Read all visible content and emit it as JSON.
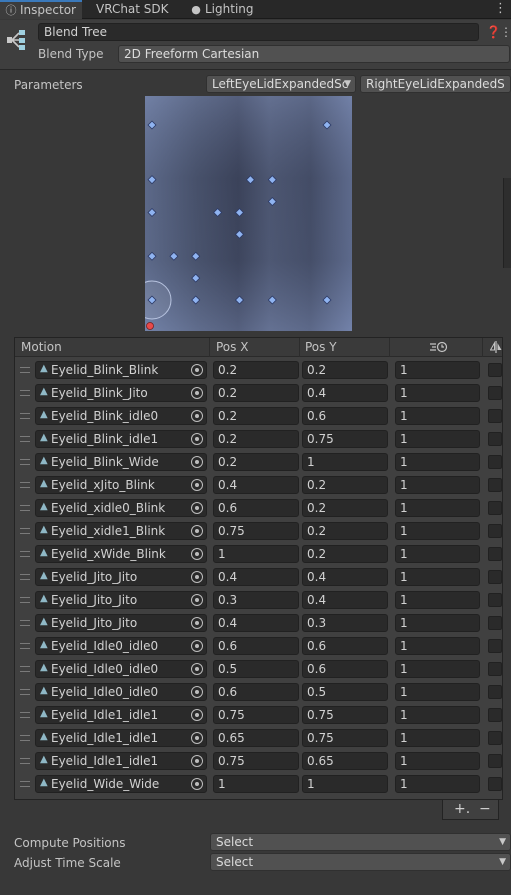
{
  "tabs": [
    {
      "label": "Inspector",
      "icon": "info-icon",
      "active": true
    },
    {
      "label": "VRChat SDK",
      "icon": "",
      "active": false
    },
    {
      "label": "Lighting",
      "icon": "lightbulb-icon",
      "active": false
    }
  ],
  "header": {
    "name": "Blend Tree",
    "blend_type_label": "Blend Type",
    "blend_type_value": "2D Freeform Cartesian"
  },
  "parameters": {
    "label": "Parameters",
    "x_param": "LeftEyeLidExpandedSc",
    "y_param": "RightEyeLidExpandedS"
  },
  "table": {
    "headers": {
      "motion": "Motion",
      "pos_x": "Pos X",
      "pos_y": "Pos Y"
    },
    "rows": [
      {
        "motion": "Eyelid_Blink_Blink",
        "x": "0.2",
        "y": "0.2",
        "speed": "1"
      },
      {
        "motion": "Eyelid_Blink_Jito",
        "x": "0.2",
        "y": "0.4",
        "speed": "1"
      },
      {
        "motion": "Eyelid_Blink_idle0",
        "x": "0.2",
        "y": "0.6",
        "speed": "1"
      },
      {
        "motion": "Eyelid_Blink_idle1",
        "x": "0.2",
        "y": "0.75",
        "speed": "1"
      },
      {
        "motion": "Eyelid_Blink_Wide",
        "x": "0.2",
        "y": "1",
        "speed": "1"
      },
      {
        "motion": "Eyelid_xJito_Blink",
        "x": "0.4",
        "y": "0.2",
        "speed": "1"
      },
      {
        "motion": "Eyelid_xidle0_Blink",
        "x": "0.6",
        "y": "0.2",
        "speed": "1"
      },
      {
        "motion": "Eyelid_xidle1_Blink",
        "x": "0.75",
        "y": "0.2",
        "speed": "1"
      },
      {
        "motion": "Eyelid_xWide_Blink",
        "x": "1",
        "y": "0.2",
        "speed": "1"
      },
      {
        "motion": "Eyelid_Jito_Jito",
        "x": "0.4",
        "y": "0.4",
        "speed": "1"
      },
      {
        "motion": "Eyelid_Jito_Jito",
        "x": "0.3",
        "y": "0.4",
        "speed": "1"
      },
      {
        "motion": "Eyelid_Jito_Jito",
        "x": "0.4",
        "y": "0.3",
        "speed": "1"
      },
      {
        "motion": "Eyelid_Idle0_idle0",
        "x": "0.6",
        "y": "0.6",
        "speed": "1"
      },
      {
        "motion": "Eyelid_Idle0_idle0",
        "x": "0.5",
        "y": "0.6",
        "speed": "1"
      },
      {
        "motion": "Eyelid_Idle0_idle0",
        "x": "0.6",
        "y": "0.5",
        "speed": "1"
      },
      {
        "motion": "Eyelid_Idle1_idle1",
        "x": "0.75",
        "y": "0.75",
        "speed": "1"
      },
      {
        "motion": "Eyelid_Idle1_idle1",
        "x": "0.65",
        "y": "0.75",
        "speed": "1"
      },
      {
        "motion": "Eyelid_Idle1_idle1",
        "x": "0.75",
        "y": "0.65",
        "speed": "1"
      },
      {
        "motion": "Eyelid_Wide_Wide",
        "x": "1",
        "y": "1",
        "speed": "1"
      }
    ]
  },
  "footer": {
    "add": "+.",
    "remove": "−"
  },
  "compute_positions": {
    "label": "Compute Positions",
    "value": "Select"
  },
  "adjust_time_scale": {
    "label": "Adjust Time Scale",
    "value": "Select"
  },
  "graph": {
    "current_x": 0.0,
    "current_y": 0.0
  },
  "colors": {
    "accent": "#3a79bb",
    "point": "#8fb3f0",
    "current": "#e84a4a"
  }
}
